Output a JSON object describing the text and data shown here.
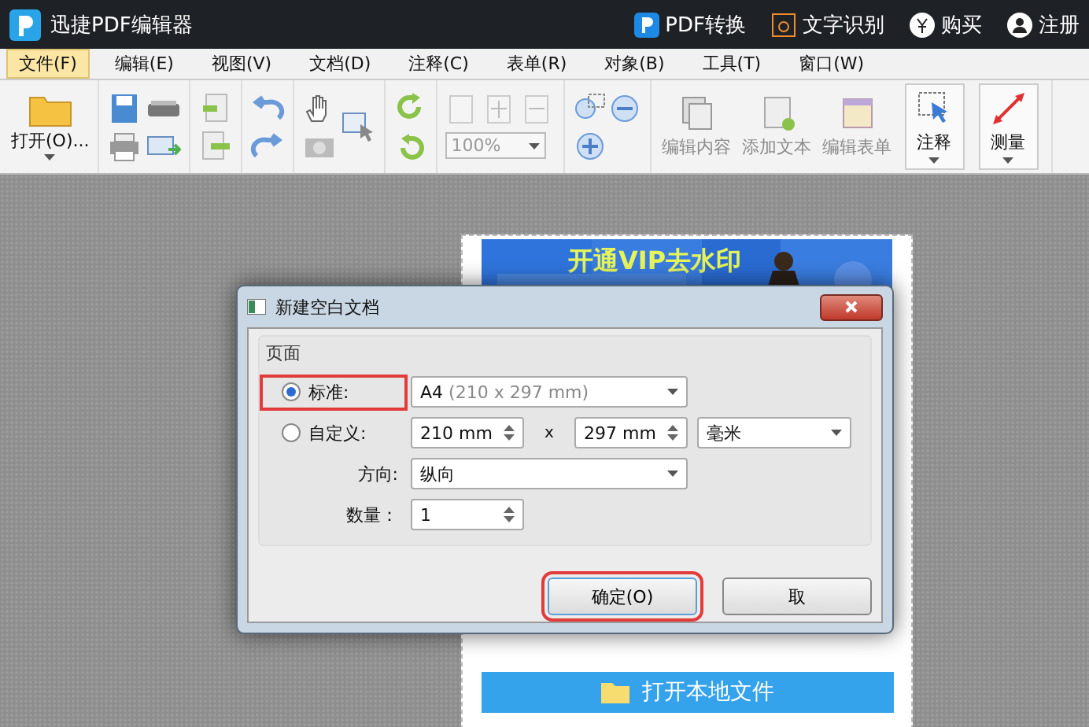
{
  "title_bar": {
    "title": "迅捷PDF编辑器",
    "actions": [
      {
        "kind": "convert",
        "label": "PDF转换"
      },
      {
        "kind": "ocr",
        "label": "文字识别"
      },
      {
        "kind": "buy",
        "label": "购买"
      },
      {
        "kind": "user",
        "label": "注册"
      }
    ]
  },
  "menu": [
    {
      "label": "文件(F)",
      "selected": true
    },
    {
      "label": "编辑(E)",
      "selected": false
    },
    {
      "label": "视图(V)",
      "selected": false
    },
    {
      "label": "文档(D)",
      "selected": false
    },
    {
      "label": "注释(C)",
      "selected": false
    },
    {
      "label": "表单(R)",
      "selected": false
    },
    {
      "label": "对象(B)",
      "selected": false
    },
    {
      "label": "工具(T)",
      "selected": false
    },
    {
      "label": "窗口(W)",
      "selected": false
    }
  ],
  "toolbar": {
    "open_label": "打开(O)...",
    "zoom": {
      "value": "100%",
      "disabled": true
    },
    "tools": [
      {
        "kind": "edit",
        "label": "编辑内容",
        "disabled": true
      },
      {
        "kind": "addtext",
        "label": "添加文本",
        "disabled": true
      },
      {
        "kind": "form",
        "label": "编辑表单",
        "disabled": true
      },
      {
        "kind": "annotate",
        "label": "注释",
        "disabled": false
      },
      {
        "kind": "measure",
        "label": "测量",
        "disabled": false
      }
    ]
  },
  "document": {
    "banner": "开通VIP去水印",
    "open_button": "打开本地文件"
  },
  "dialog": {
    "title": "新建空白文档",
    "group": "页面",
    "standard": {
      "label": "标准:",
      "selected": true,
      "highlighted": true,
      "value": "A4",
      "detail": "(210 x 297 mm)"
    },
    "custom": {
      "label": "自定义:",
      "selected": false,
      "width": "210 mm",
      "times": "x",
      "height": "297 mm",
      "unit": "毫米"
    },
    "orientation": {
      "label": "方向:",
      "value": "纵向"
    },
    "count": {
      "label": "数量：",
      "value": "1"
    },
    "buttons": [
      {
        "label": "确定(O)",
        "highlighted": true
      },
      {
        "label": "取",
        "highlighted": false
      }
    ]
  }
}
